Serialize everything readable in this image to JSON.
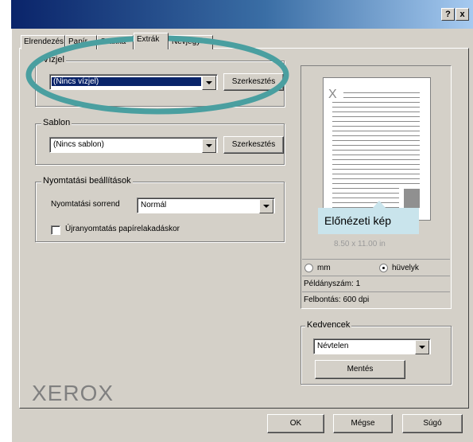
{
  "titlebar": {
    "help_label": "?",
    "close_label": "x"
  },
  "tabs": [
    {
      "label": "Elrendezés",
      "active": false
    },
    {
      "label": "Papír",
      "active": false
    },
    {
      "label": "Grafika",
      "active": false
    },
    {
      "label": "Extrák",
      "active": true
    },
    {
      "label": "Névjegy",
      "active": false
    }
  ],
  "watermark": {
    "group_label": "Vízjel",
    "selected": "(Nincs vízjel)",
    "edit_label": "Szerkesztés"
  },
  "overlay": {
    "group_label": "Sablon",
    "selected": "(Nincs sablon)",
    "edit_label": "Szerkesztés"
  },
  "print_options": {
    "group_label": "Nyomtatási beállítások",
    "order_label": "Nyomtatási sorrend",
    "order_value": "Normál",
    "reprint_label": "Újranyomtatás papírelakadáskor"
  },
  "preview": {
    "callout": "Előnézeti kép",
    "caption": "8.50 x 11.00 in",
    "unit_mm": "mm",
    "unit_inch": "hüvelyk",
    "unit_selected": "hüvelyk",
    "copies": "Példányszám: 1",
    "resolution": "Felbontás: 600 dpi"
  },
  "favorites": {
    "group_label": "Kedvencek",
    "selected": "Névtelen",
    "save_label": "Mentés"
  },
  "logo": "XEROX",
  "footer": {
    "ok_label": "OK",
    "cancel_label": "Mégse",
    "help_label": "Súgó"
  },
  "colors": {
    "highlight_ellipse": "#4a9fa0",
    "callout_bg": "#c9e4ec",
    "titlebar": "#0a246a"
  }
}
